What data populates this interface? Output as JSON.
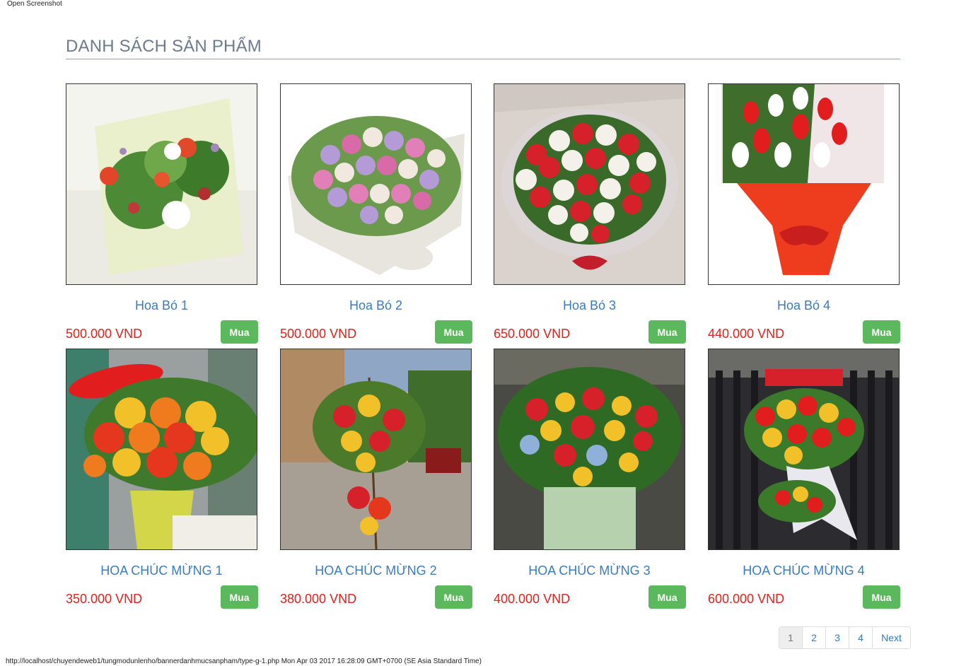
{
  "window": {
    "top_label": "Open Screenshot"
  },
  "section": {
    "title": "DANH SÁCH SẢN PHẨM"
  },
  "products": [
    {
      "name": "Hoa Bó 1",
      "price": "500.000 VND",
      "buy_label": "Mua",
      "image": "bouquet-mixed-green-icon"
    },
    {
      "name": "Hoa Bó 2",
      "price": "500.000 VND",
      "buy_label": "Mua",
      "image": "bouquet-pastel-roses-icon"
    },
    {
      "name": "Hoa Bó 3",
      "price": "650.000 VND",
      "buy_label": "Mua",
      "image": "bouquet-red-white-roses-icon"
    },
    {
      "name": "Hoa Bó 4",
      "price": "440.000 VND",
      "buy_label": "Mua",
      "image": "bouquet-red-white-tulips-icon"
    },
    {
      "name": "HOA CHÚC MỪNG 1",
      "price": "350.000 VND",
      "buy_label": "Mua",
      "image": "congrats-stand-orange-icon"
    },
    {
      "name": "HOA CHÚC MỪNG 2",
      "price": "380.000 VND",
      "buy_label": "Mua",
      "image": "congrats-stand-street-icon"
    },
    {
      "name": "HOA CHÚC MỪNG 3",
      "price": "400.000 VND",
      "buy_label": "Mua",
      "image": "congrats-stand-sunflower-icon"
    },
    {
      "name": "HOA CHÚC MỪNG 4",
      "price": "600.000 VND",
      "buy_label": "Mua",
      "image": "congrats-stand-red-icon"
    }
  ],
  "pagination": {
    "pages": [
      "1",
      "2",
      "3",
      "4"
    ],
    "active": "1",
    "next_label": "Next"
  },
  "status_bar": {
    "text": "http://localhost/chuyendeweb1/tungmodunlenho/bannerdanhmucsanpham/type-g-1.php Mon Apr 03 2017 16:28:09 GMT+0700 (SE Asia Standard Time)"
  },
  "colors": {
    "title": "#6c7b8c",
    "product_name": "#3a7bbf",
    "price": "#e0201b",
    "buy_button": "#5cb85c",
    "pagination_link": "#337ab7"
  }
}
